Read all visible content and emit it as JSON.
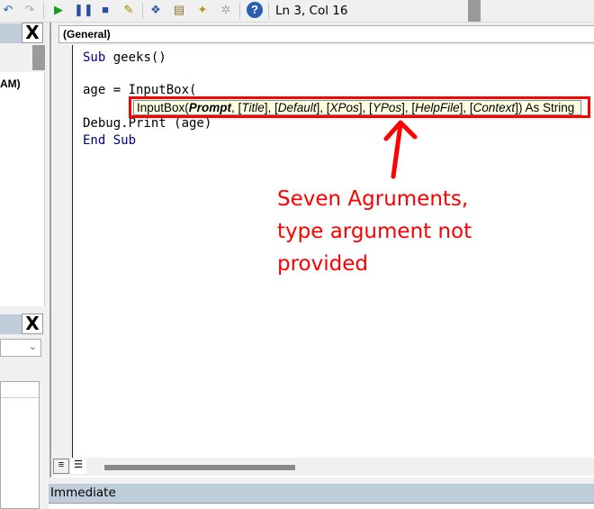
{
  "toolbar": {
    "icons": [
      "undo-icon",
      "redo-icon",
      "run-icon",
      "pause-icon",
      "stop-icon",
      "design-mode-icon",
      "project-explorer-icon",
      "properties-icon",
      "object-browser-icon",
      "toolbox-icon",
      "help-icon"
    ],
    "status": "Ln 3, Col 16"
  },
  "project_pane": {
    "close": "X",
    "item_text": "AM)"
  },
  "properties_pane": {
    "close": "X"
  },
  "code_window": {
    "object_combo": "(General)",
    "lines": {
      "l1_kw": "Sub",
      "l1_rest": " geeks()",
      "l3": "age = InputBox(",
      "l4": "Debug.Print (age)",
      "l5": "End Sub"
    }
  },
  "tooltip": {
    "p0": "InputBox(",
    "p1": "Prompt",
    "p2": ", [",
    "p3": "Title",
    "p4": "], [",
    "p5": "Default",
    "p6": "], [",
    "p7": "XPos",
    "p8": "], [",
    "p9": "YPos",
    "p10": "], [",
    "p11": "HelpFile",
    "p12": "], [",
    "p13": "Context",
    "p14": "]) As String"
  },
  "annotation": {
    "lines": [
      "Seven Agruments,",
      "type argument not",
      "provided"
    ],
    "color": "#ff0000"
  },
  "immediate": {
    "title": "Immediate"
  }
}
